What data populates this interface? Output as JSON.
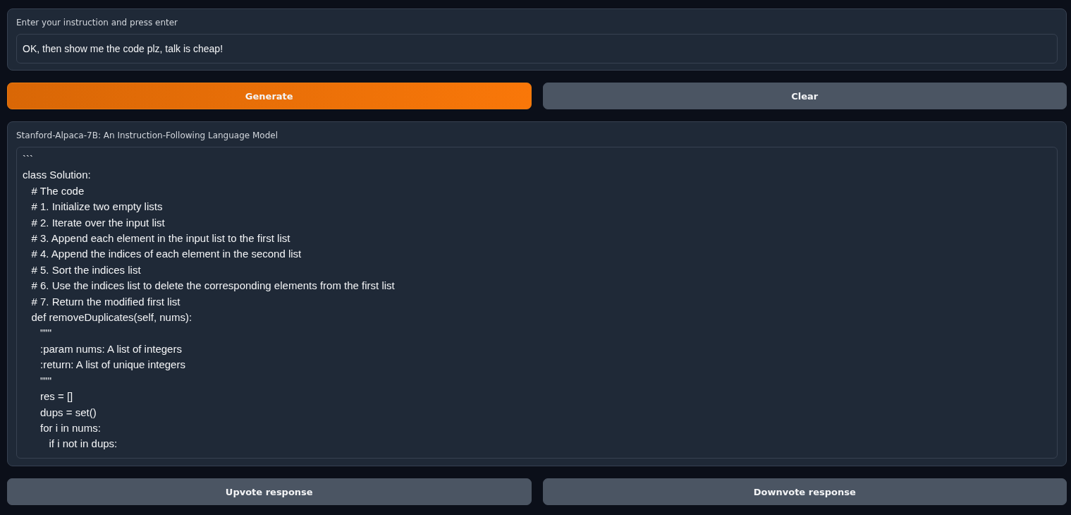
{
  "instruction": {
    "label": "Enter your instruction and press enter",
    "value": "OK, then show me the code plz, talk is cheap!"
  },
  "actions": [
    {
      "label": "Generate",
      "kind": "primary"
    },
    {
      "label": "Clear",
      "kind": "secondary"
    }
  ],
  "output": {
    "label": "Stanford-Alpaca-7B: An Instruction-Following Language Model",
    "lines": [
      "```",
      "class Solution:",
      "   # The code",
      "   # 1. Initialize two empty lists",
      "   # 2. Iterate over the input list",
      "   # 3. Append each element in the input list to the first list",
      "   # 4. Append the indices of each element in the second list",
      "   # 5. Sort the indices list",
      "   # 6. Use the indices list to delete the corresponding elements from the first list",
      "   # 7. Return the modified first list",
      "   def removeDuplicates(self, nums):",
      "      \"\"\"",
      "      :param nums: A list of integers",
      "      :return: A list of unique integers",
      "      \"\"\"",
      "      res = []",
      "      dups = set()",
      "      for i in nums:",
      "         if i not in dups:"
    ]
  },
  "feedback": [
    {
      "label": "Upvote response",
      "kind": "secondary"
    },
    {
      "label": "Downvote response",
      "kind": "secondary"
    }
  ]
}
